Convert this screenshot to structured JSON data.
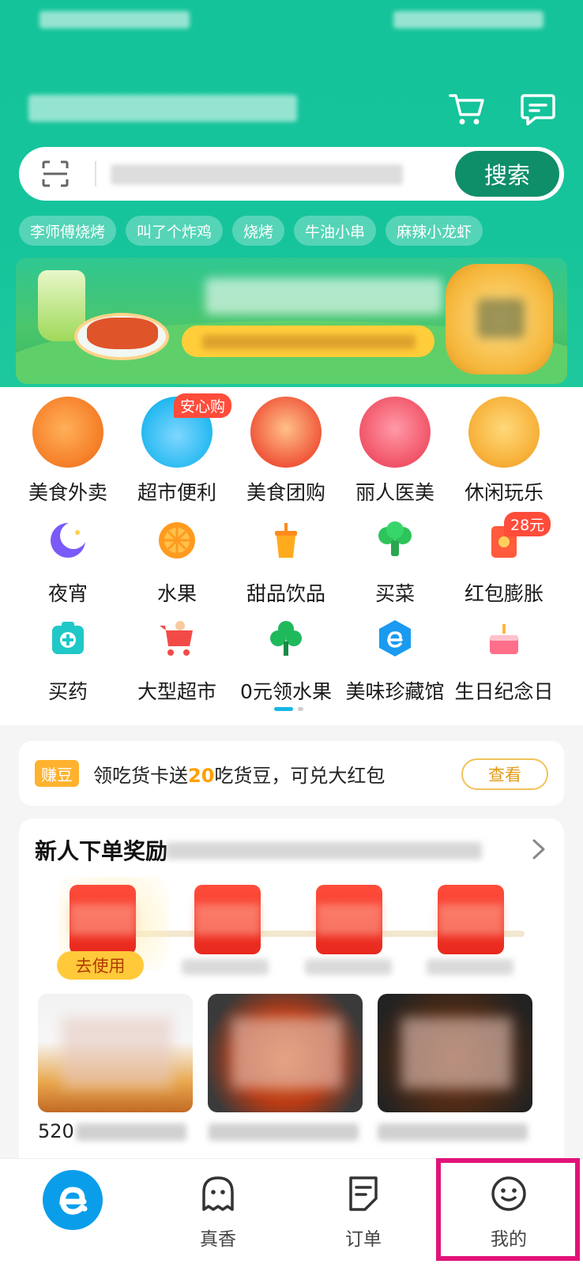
{
  "search": {
    "button_label": "搜索",
    "placeholder": ""
  },
  "hot_tags": [
    "李师傅烧烤",
    "叫了个炸鸡",
    "烧烤",
    "牛油小串",
    "麻辣小龙虾"
  ],
  "categories_row1": [
    {
      "label": "美食外卖",
      "icon": "drumstick-icon",
      "color": "#f7842d"
    },
    {
      "label": "超市便利",
      "icon": "shopping-basket-icon",
      "color": "#22b8f0",
      "badge": "安心购"
    },
    {
      "label": "美食团购",
      "icon": "fork-ticket-icon",
      "color": "#f0573a"
    },
    {
      "label": "丽人医美",
      "icon": "lady-icon",
      "color": "#f2586b"
    },
    {
      "label": "休闲玩乐",
      "icon": "gift-box-icon",
      "color": "#f7b13a"
    }
  ],
  "categories_row2": [
    {
      "label": "夜宵",
      "icon": "moon-icon",
      "color": "#7a5af8"
    },
    {
      "label": "水果",
      "icon": "orange-icon",
      "color": "#ff9a1f"
    },
    {
      "label": "甜品饮品",
      "icon": "drink-cup-icon",
      "color": "#ffab1d"
    },
    {
      "label": "买菜",
      "icon": "broccoli-icon",
      "color": "#2cc45b"
    },
    {
      "label": "红包膨胀",
      "icon": "red-packet-icon",
      "color": "#ff5b3c",
      "badge": "28元"
    }
  ],
  "categories_row3": [
    {
      "label": "买药",
      "icon": "medicine-box-icon",
      "color": "#20c8c8"
    },
    {
      "label": "大型超市",
      "icon": "shopping-cart-icon",
      "color": "#f24b47"
    },
    {
      "label": "0元领水果",
      "icon": "tree-icon",
      "color": "#1fb85b"
    },
    {
      "label": "美味珍藏馆",
      "icon": "e-badge-icon",
      "color": "#1a9af0"
    },
    {
      "label": "生日纪念日",
      "icon": "cake-icon",
      "color": "#ff6f8a"
    }
  ],
  "bean": {
    "badge": "赚豆",
    "text_before": "领吃货卡送",
    "number": "20",
    "text_after": "吃货豆，可兑大红包",
    "button": "查看"
  },
  "newcomer": {
    "title": "新人下单奖励",
    "use_button": "去使用",
    "food1_label": "520"
  },
  "nav": [
    {
      "label": "",
      "icon": "eleme-logo-icon"
    },
    {
      "label": "真香",
      "icon": "ghost-face-icon"
    },
    {
      "label": "订单",
      "icon": "order-doc-icon"
    },
    {
      "label": "我的",
      "icon": "smile-face-icon"
    }
  ],
  "colors": {
    "header_green": "#16c49b",
    "search_button": "#0f8e6a",
    "accent_blue": "#0a9eea",
    "highlight_box": "#e2137a"
  }
}
